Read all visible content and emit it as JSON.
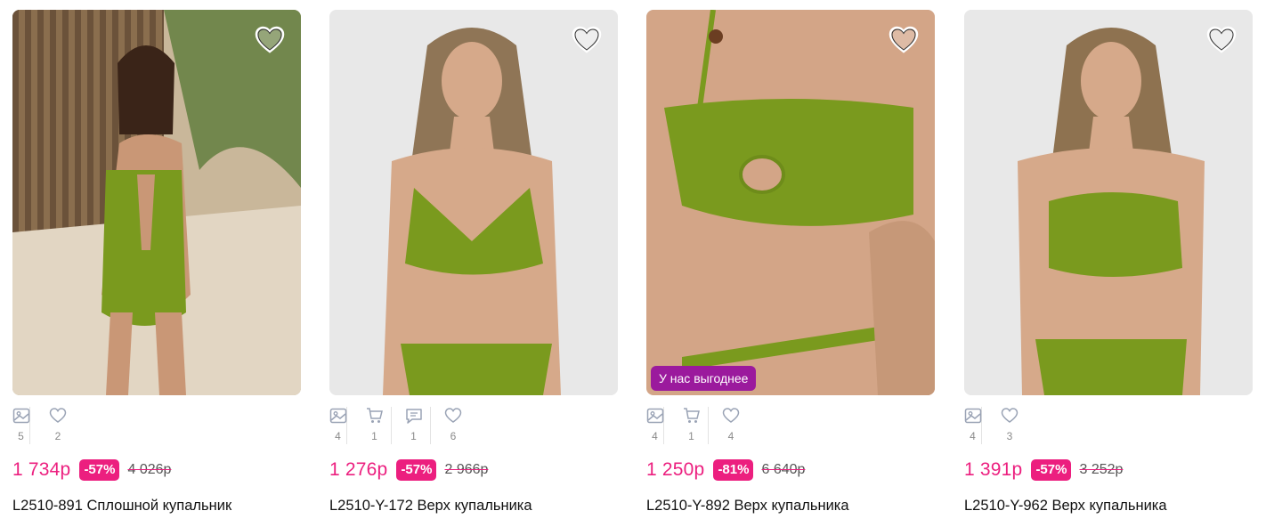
{
  "products": [
    {
      "image": "model in green one-piece swimsuit on beach",
      "stats": [
        {
          "icon": "photo-icon",
          "count": "5"
        },
        {
          "icon": "heart-icon",
          "count": "2"
        }
      ],
      "price": "1 734р",
      "discount": "-57%",
      "old_price": "4 026р",
      "title": "L2510-891 Сплошной купальник"
    },
    {
      "image": "model in green halter bikini",
      "stats": [
        {
          "icon": "photo-icon",
          "count": "4"
        },
        {
          "icon": "cart-icon",
          "count": "1"
        },
        {
          "icon": "comment-icon",
          "count": "1"
        },
        {
          "icon": "heart-icon",
          "count": "6"
        }
      ],
      "price": "1 276р",
      "discount": "-57%",
      "old_price": "2 966р",
      "title": "L2510-Y-172 Верх купальника"
    },
    {
      "image": "close-up green one-shoulder bikini top",
      "promo": "У нас выгоднее",
      "stats": [
        {
          "icon": "photo-icon",
          "count": "4"
        },
        {
          "icon": "cart-icon",
          "count": "1"
        },
        {
          "icon": "heart-icon",
          "count": "4"
        }
      ],
      "price": "1 250р",
      "discount": "-81%",
      "old_price": "6 640р",
      "title": "L2510-Y-892 Верх купальника"
    },
    {
      "image": "model in green bandeau bikini",
      "stats": [
        {
          "icon": "photo-icon",
          "count": "4"
        },
        {
          "icon": "heart-icon",
          "count": "3"
        }
      ],
      "price": "1 391р",
      "discount": "-57%",
      "old_price": "3 252р",
      "title": "L2510-Y-962 Верх купальника"
    }
  ],
  "colors": {
    "price": "#ec1f7f",
    "promo_bg": "#9b1a9d",
    "swimsuit": "#7a9a1e"
  }
}
